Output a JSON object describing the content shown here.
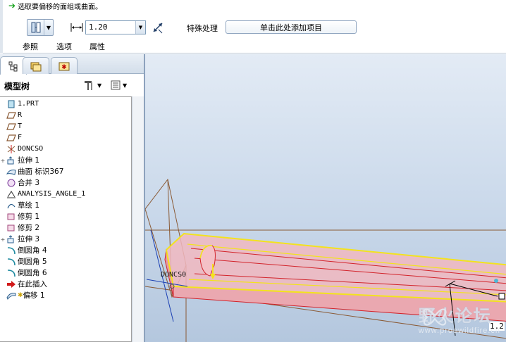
{
  "prompt": {
    "text": "选取要偏移的面组或曲面。"
  },
  "dashboard": {
    "thickness_value": "1.20",
    "special_label": "特殊处理",
    "add_item_label": "单击此处添加项目",
    "tabs": [
      {
        "label": "参照"
      },
      {
        "label": "选项"
      },
      {
        "label": "属性"
      }
    ]
  },
  "model_tree": {
    "title": "模型树",
    "items": [
      {
        "label": "1.PRT",
        "icon": "part-icon",
        "expander": false
      },
      {
        "label": "R",
        "icon": "datum-plane-icon",
        "expander": false
      },
      {
        "label": "T",
        "icon": "datum-plane-icon",
        "expander": false
      },
      {
        "label": "F",
        "icon": "datum-plane-icon",
        "expander": false
      },
      {
        "label": "DONCSO",
        "icon": "coordinate-system-icon",
        "expander": false
      },
      {
        "label": "拉伸 1",
        "icon": "extrude-icon",
        "expander": true
      },
      {
        "label": "曲面 标识367",
        "icon": "surface-icon",
        "expander": false
      },
      {
        "label": "合并 3",
        "icon": "merge-icon",
        "expander": false
      },
      {
        "label": "ANALYSIS_ANGLE_1",
        "icon": "analysis-icon",
        "expander": false
      },
      {
        "label": "草绘 1",
        "icon": "sketch-icon",
        "expander": false
      },
      {
        "label": "修剪 1",
        "icon": "trim-icon",
        "expander": false
      },
      {
        "label": "修剪 2",
        "icon": "trim-icon",
        "expander": false
      },
      {
        "label": "拉伸 3",
        "icon": "extrude-icon",
        "expander": true
      },
      {
        "label": "倒圆角 4",
        "icon": "round-icon",
        "expander": false
      },
      {
        "label": "倒圆角 5",
        "icon": "round-icon",
        "expander": false
      },
      {
        "label": "倒圆角 6",
        "icon": "round-icon",
        "expander": false
      },
      {
        "label": "在此插入",
        "icon": "insert-here-icon",
        "expander": false
      },
      {
        "label": "偏移 1",
        "icon": "offset-icon",
        "expander": false
      }
    ]
  },
  "viewport": {
    "csys_label": "DONCS0",
    "dimension_label": "1.2",
    "watermark_cn": "野火论坛",
    "watermark_url": "www.proewildfire.cn"
  },
  "colors": {
    "viewport_top": "#e3ebf5",
    "viewport_bottom": "#b4c7de",
    "selection_fill": "#f1b9bf",
    "edge_yellow": "#f3e31d",
    "edge_red": "#d2232a",
    "datum_brown": "#8a5a35"
  }
}
